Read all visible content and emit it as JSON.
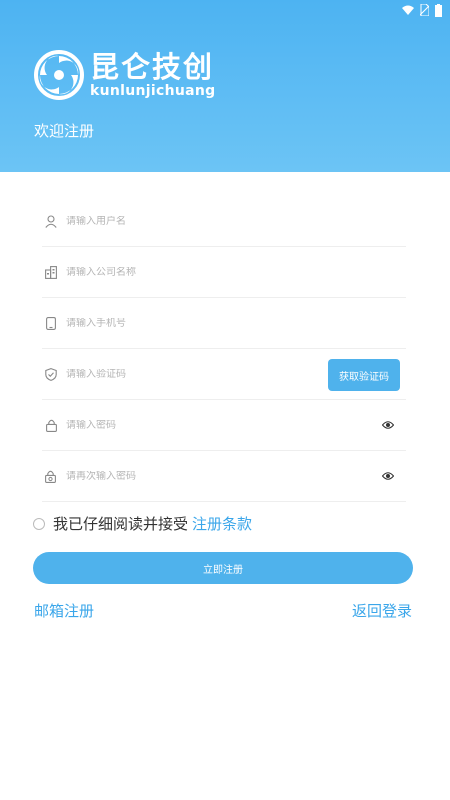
{
  "brand": {
    "name_cn": "昆仑技创",
    "name_en": "kunlunjichuang"
  },
  "header": {
    "welcome": "欢迎注册"
  },
  "form": {
    "username_placeholder": "请输入用户名",
    "company_placeholder": "请输入公司名称",
    "phone_placeholder": "请输入手机号",
    "code_placeholder": "请输入验证码",
    "get_code_label": "获取验证码",
    "password_placeholder": "请输入密码",
    "confirm_password_placeholder": "请再次输入密码"
  },
  "agreement": {
    "text": "我已仔细阅读并接受",
    "link": "注册条款",
    "checked": false
  },
  "actions": {
    "register_label": "立即注册",
    "email_register": "邮箱注册",
    "back_to_login": "返回登录"
  },
  "colors": {
    "header_top": "#4db3f2",
    "header_bottom": "#6cc4f5",
    "accent": "#4fb2ec",
    "link": "#3aa6ea"
  },
  "icons": {
    "status": [
      "wifi-icon",
      "no-sim-icon",
      "battery-icon"
    ],
    "fields": [
      "user-icon",
      "building-icon",
      "phone-icon",
      "shield-icon",
      "lock-icon",
      "lock-refresh-icon"
    ],
    "password_toggle": "eye-icon"
  }
}
